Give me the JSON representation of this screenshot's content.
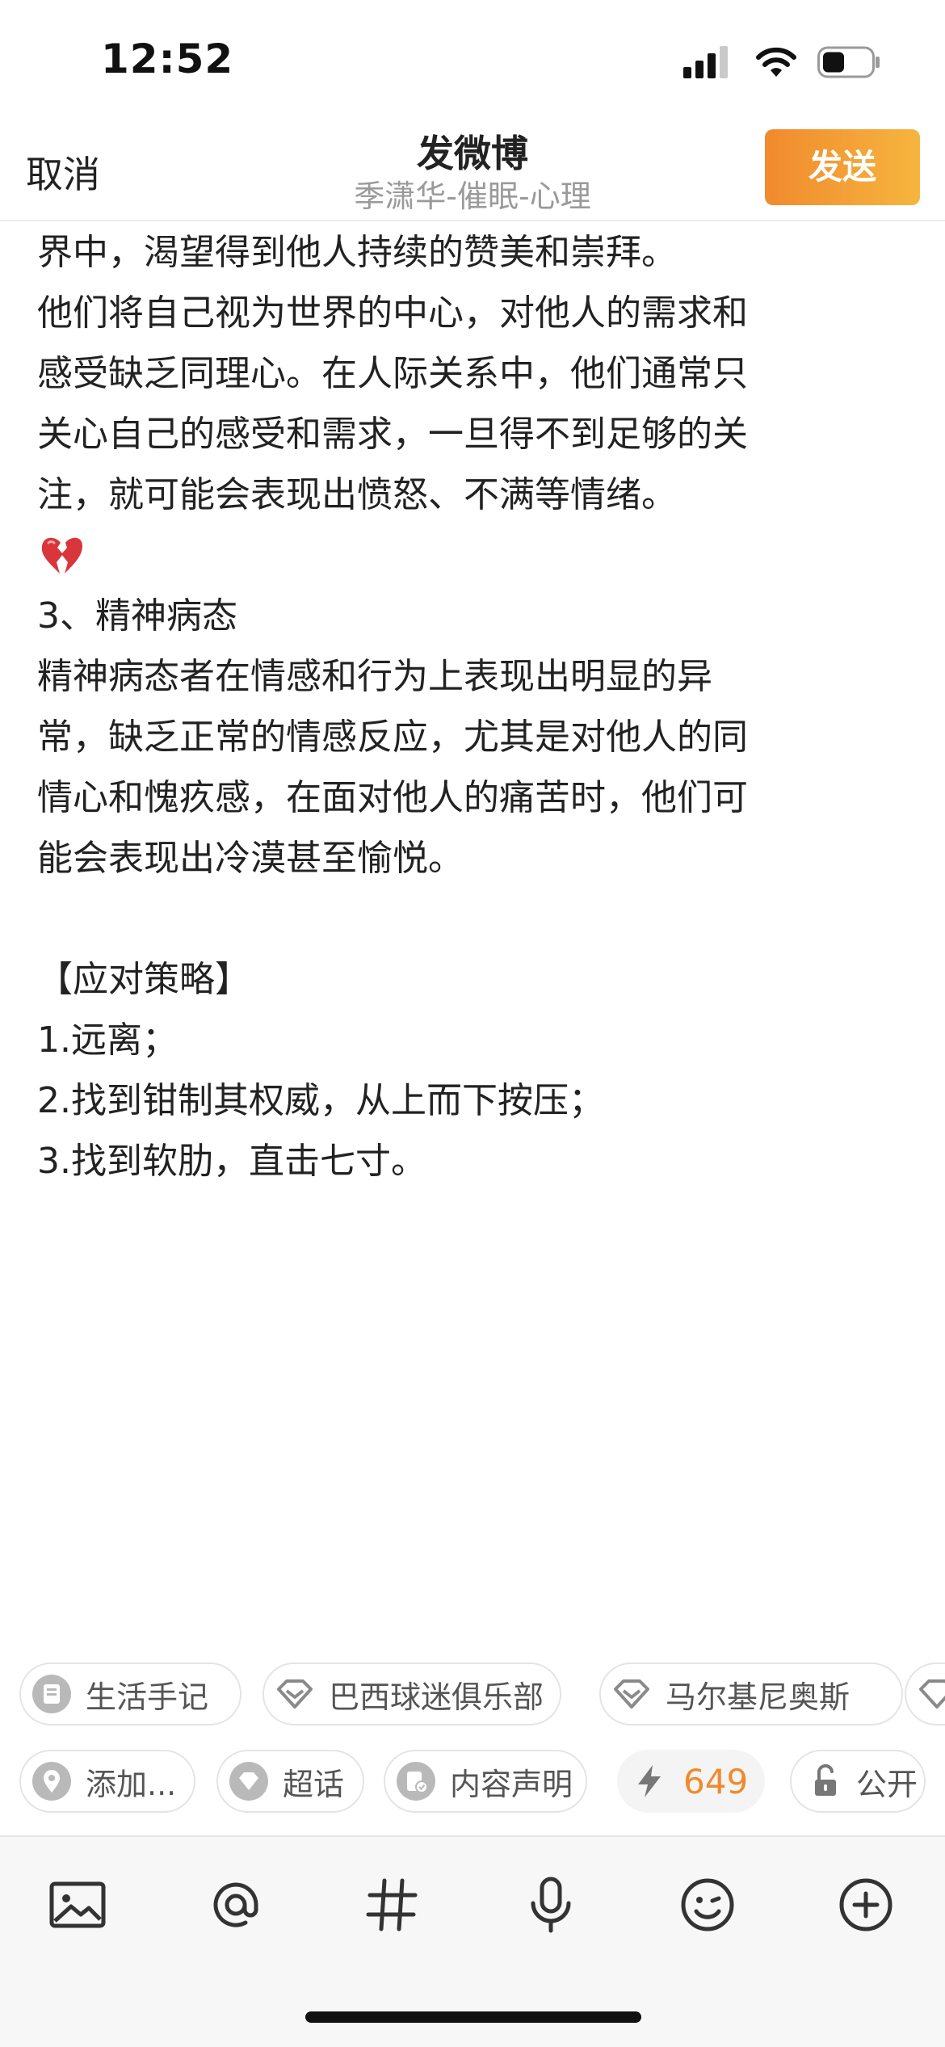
{
  "status_bar": {
    "time": "12:52"
  },
  "nav": {
    "cancel_label": "取消",
    "title": "发微博",
    "subtitle": "季潇华-催眠-心理",
    "send_label": "发送"
  },
  "content": {
    "lines": [
      "界中，渴望得到他人持续的赞美和崇拜。",
      "他们将自己视为世界的中心，对他人的需求和",
      "感受缺乏同理心。在人际关系中，他们通常只",
      "关心自己的感受和需求，一旦得不到足够的关",
      "注，就可能会表现出愤怒、不满等情绪。",
      "3、精神病态",
      "精神病态者在情感和行为上表现出明显的异",
      "常，缺乏正常的情感反应，尤其是对他人的同",
      "情心和愧疚感，在面对他人的痛苦时，他们可",
      "能会表现出冷漠甚至愉悦。",
      "【应对策略】",
      "1.远离；",
      "2.找到钳制其权威，从上而下按压；",
      "3.找到软肋，直击七寸。"
    ],
    "emoji_icon": "broken-heart-icon"
  },
  "chips_row1": [
    {
      "label": "生活手记",
      "icon": "notebook-icon"
    },
    {
      "label": "巴西球迷俱乐部",
      "icon": "diamond-icon"
    },
    {
      "label": "马尔基尼奥斯",
      "icon": "diamond-icon"
    }
  ],
  "chips_row2": [
    {
      "label": "添加...",
      "icon": "location-pin-icon"
    },
    {
      "label": "超话",
      "icon": "diamond-badge-icon"
    },
    {
      "label": "内容声明",
      "icon": "statement-icon"
    },
    {
      "label": "649",
      "icon": "lightning-icon"
    },
    {
      "label": "公开",
      "icon": "unlock-icon"
    }
  ],
  "toolbar": {
    "icons": [
      "image-icon",
      "at-icon",
      "hashtag-icon",
      "microphone-icon",
      "emoji-icon",
      "add-icon"
    ]
  },
  "colors": {
    "accent_start": "#f08a2e",
    "accent_end": "#f6b53e",
    "count_orange": "#ef8a2e",
    "subtitle_grey": "#9a9a9a"
  }
}
